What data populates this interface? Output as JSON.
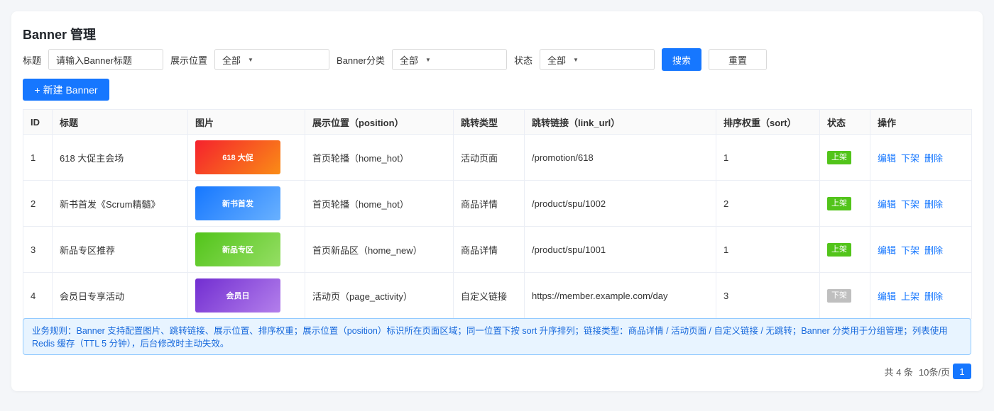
{
  "page": {
    "title": "Banner 管理"
  },
  "filters": {
    "title_label": "标题",
    "title_placeholder": "请输入Banner标题",
    "position_label": "展示位置",
    "position_value": "全部",
    "category_label": "Banner分类",
    "category_value": "全部",
    "status_label": "状态",
    "status_value": "全部",
    "search_label": "搜索",
    "reset_label": "重置"
  },
  "toolbar": {
    "new_plus": "+",
    "new_label": "新建 Banner"
  },
  "table": {
    "headers": [
      "ID",
      "标题",
      "图片",
      "展示位置（position）",
      "跳转类型",
      "跳转链接（link_url）",
      "排序权重（sort）",
      "状态",
      "操作"
    ],
    "rows": [
      {
        "id": "1",
        "title": "618 大促主会场",
        "image_text": "618 大促",
        "position": "首页轮播（home_hot）",
        "jump_type": "活动页面",
        "link": "/promotion/618",
        "sort": "1",
        "status": "上架",
        "actions": [
          "编辑",
          "下架",
          "删除"
        ]
      },
      {
        "id": "2",
        "title": "新书首发《Scrum精髓》",
        "image_text": "新书首发",
        "position": "首页轮播（home_hot）",
        "jump_type": "商品详情",
        "link": "/product/spu/1002",
        "sort": "2",
        "status": "上架",
        "actions": [
          "编辑",
          "下架",
          "删除"
        ]
      },
      {
        "id": "3",
        "title": "新品专区推荐",
        "image_text": "新品专区",
        "position": "首页新品区（home_new）",
        "jump_type": "商品详情",
        "link": "/product/spu/1001",
        "sort": "1",
        "status": "上架",
        "actions": [
          "编辑",
          "下架",
          "删除"
        ]
      },
      {
        "id": "4",
        "title": "会员日专享活动",
        "image_text": "会员日",
        "position": "活动页（page_activity）",
        "jump_type": "自定义链接",
        "link": "https://member.example.com/day",
        "sort": "3",
        "status": "下架",
        "actions": [
          "编辑",
          "上架",
          "删除"
        ]
      }
    ]
  },
  "rules_text": "业务规则：Banner 支持配置图片、跳转链接、展示位置、排序权重；展示位置（position）标识所在页面区域；同一位置下按 sort 升序排列；链接类型：商品详情 / 活动页面 / 自定义链接 / 无跳转；Banner 分类用于分组管理；列表使用 Redis 缓存（TTL 5 分钟），后台修改时主动失效。",
  "pagination": {
    "total": "共 4 条",
    "page_size": "10条/页",
    "current_page": "1"
  },
  "colors": {
    "primary": "#1677ff",
    "status_on": "#52c41a",
    "status_off": "#bfbfbf",
    "thumb_gradients": [
      [
        "#f5222d",
        "#fa8c16"
      ],
      [
        "#1677ff",
        "#69b1ff"
      ],
      [
        "#52c41a",
        "#95de64"
      ],
      [
        "#722ed1",
        "#b37feb"
      ]
    ]
  }
}
